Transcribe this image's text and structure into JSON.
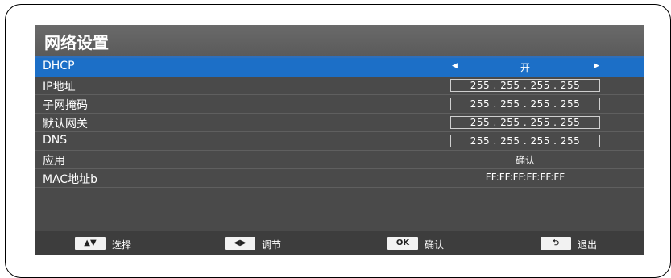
{
  "menu": {
    "title": "网络设置",
    "rows": [
      {
        "label": "DHCP",
        "value": "开"
      },
      {
        "label": "IP地址",
        "value": "255 . 255 . 255 . 255"
      },
      {
        "label": "子网掩码",
        "value": "255 . 255 . 255 . 255"
      },
      {
        "label": "默认网关",
        "value": "255 . 255 . 255 . 255"
      },
      {
        "label": "DNS",
        "value": "255 . 255 . 255 . 255"
      },
      {
        "label": "应用",
        "value": "确认"
      },
      {
        "label": "MAC地址b",
        "value": "FF:FF:FF:FF:FF:FF"
      }
    ]
  },
  "footer": {
    "select_key": "▲▼",
    "select_label": "选择",
    "adjust_key": "◀▶",
    "adjust_label": "调节",
    "ok_key": "OK",
    "ok_label": "确认",
    "back_key": "⮌",
    "back_label": "退出"
  },
  "colors": {
    "highlight": "#1c6fc7",
    "panel": "#4a4a4a",
    "title_bar": "#5f5f5f",
    "footer": "#3d3d3d"
  }
}
